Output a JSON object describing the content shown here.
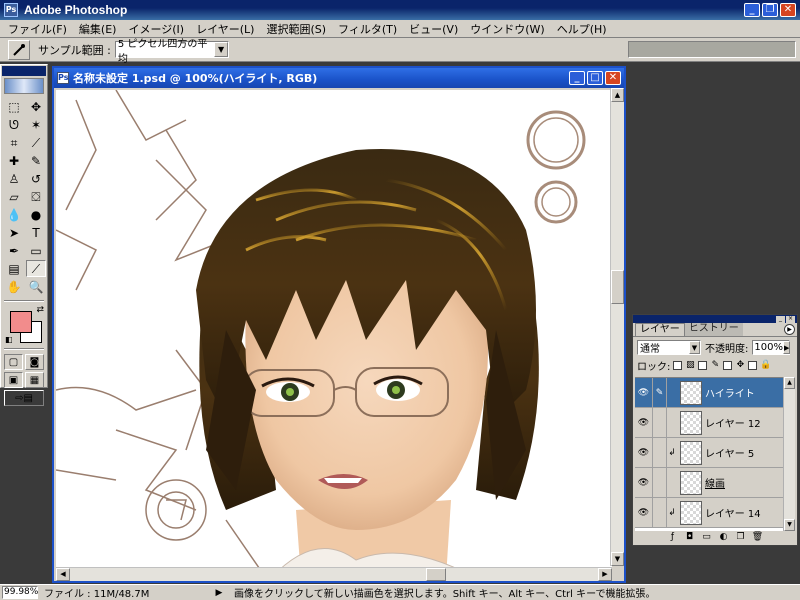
{
  "app": {
    "title": "Adobe Photoshop",
    "icon_text": "Ps"
  },
  "menubar": {
    "items": [
      "ファイル(F)",
      "編集(E)",
      "イメージ(I)",
      "レイヤー(L)",
      "選択範囲(S)",
      "フィルタ(T)",
      "ビュー(V)",
      "ウインドウ(W)",
      "ヘルプ(H)"
    ]
  },
  "options": {
    "sample_label": "サンプル範囲 :",
    "sample_value": "5 ピクセル四方の平均"
  },
  "document": {
    "title": "名称未設定 1.psd @ 100%(ハイライト, RGB)"
  },
  "colors": {
    "foreground": "#f28c8c",
    "background": "#ffffff",
    "title_gradient": "#1a52c8",
    "selected_layer": "#3a6ea5"
  },
  "layers_palette": {
    "tabs": [
      "レイヤー",
      "ヒストリー"
    ],
    "blend_mode": "通常",
    "opacity_label": "不透明度:",
    "opacity_value": "100%",
    "lock_label": "ロック:",
    "layers": [
      {
        "name": "ハイライト",
        "selected": true,
        "visible": true,
        "clipped": false
      },
      {
        "name": "レイヤー 12",
        "selected": false,
        "visible": true,
        "clipped": false
      },
      {
        "name": "レイヤー 5",
        "selected": false,
        "visible": true,
        "clipped": true
      },
      {
        "name": "線画",
        "selected": false,
        "visible": true,
        "clipped": false
      },
      {
        "name": "レイヤー 14",
        "selected": false,
        "visible": true,
        "clipped": true
      }
    ]
  },
  "statusbar": {
    "zoom": "99.98%",
    "file_info": "ファイル : 11M/48.7M",
    "hint": "画像をクリックして新しい描画色を選択します。Shift キー、Alt キー、Ctrl キーで機能拡張。"
  }
}
